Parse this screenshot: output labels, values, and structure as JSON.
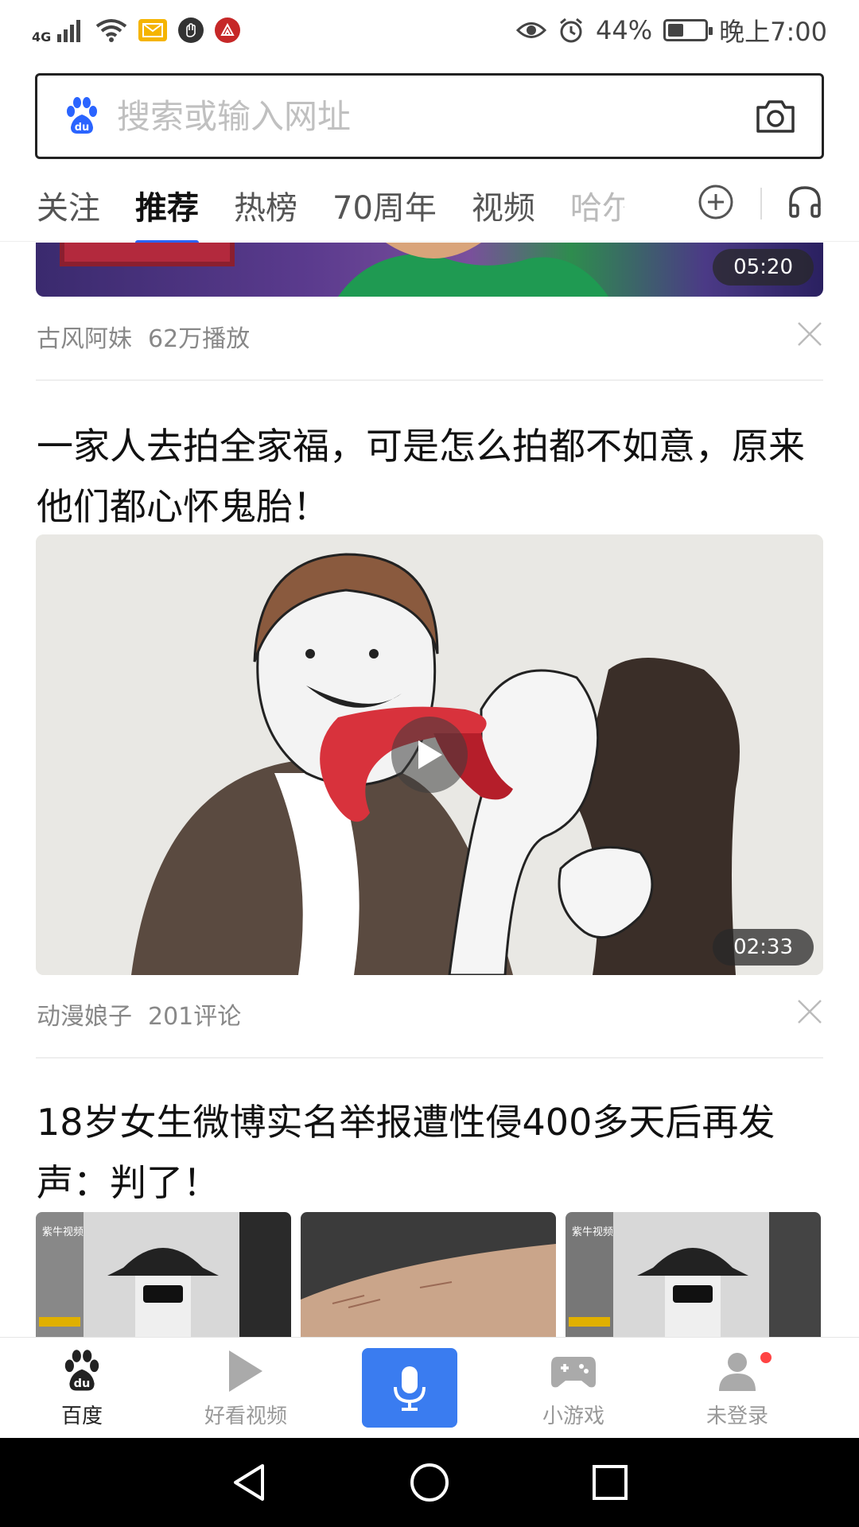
{
  "status_bar": {
    "network": "4G",
    "battery_text": "44%",
    "battery_level": 0.44,
    "time": "晚上7:00"
  },
  "search": {
    "placeholder": "搜索或输入网址"
  },
  "tabs": [
    {
      "label": "关注"
    },
    {
      "label": "推荐"
    },
    {
      "label": "热榜"
    },
    {
      "label": "70周年"
    },
    {
      "label": "视频"
    },
    {
      "label": "哈尔"
    }
  ],
  "feed": {
    "item1": {
      "duration": "05:20",
      "author": "古风阿妹",
      "stat": "62万播放"
    },
    "item2": {
      "title": "一家人去拍全家福，可是怎么拍都不如意，原来他们都心怀鬼胎！",
      "duration": "02:33",
      "author": "动漫娘子",
      "stat": "201评论"
    },
    "item3": {
      "title": "18岁女生微博实名举报遭性侵400多天后再发声：判了！",
      "thumb_label_1": "紫牛视频",
      "thumb_label_3": "紫牛视频"
    }
  },
  "bottom_nav": {
    "home": "百度",
    "video": "好看视频",
    "games": "小游戏",
    "profile": "未登录"
  },
  "colors": {
    "accent": "#2a64ff",
    "voice_button": "#3a7cf0",
    "notification_dot": "#ff4444"
  }
}
